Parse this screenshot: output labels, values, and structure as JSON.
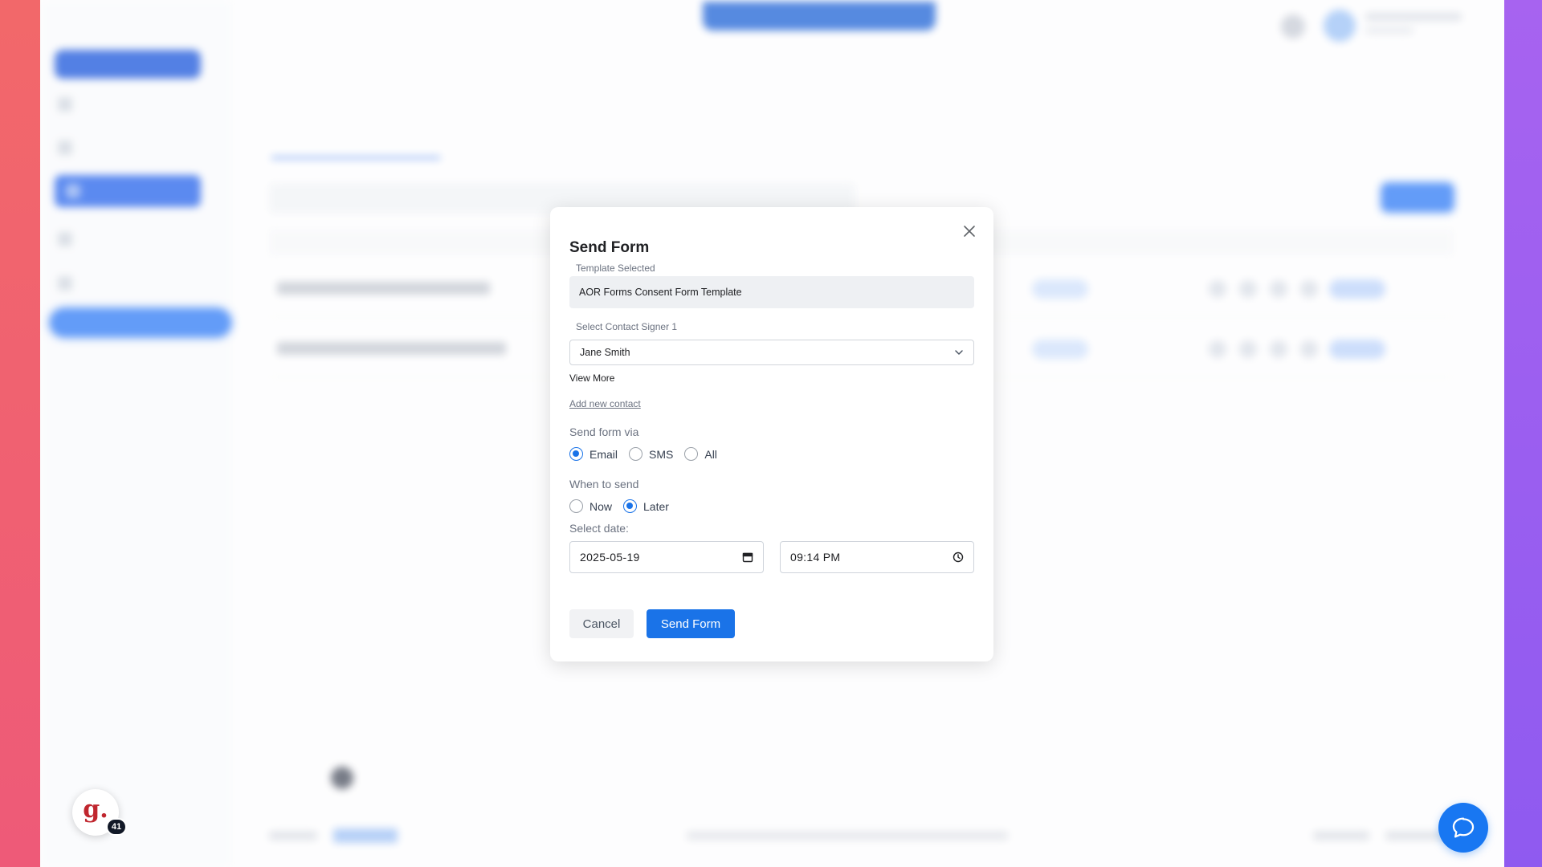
{
  "modal": {
    "title": "Send Form",
    "template_label": "Template Selected",
    "template_value": "AOR Forms Consent Form Template",
    "signer_label": "Select Contact Signer 1",
    "signer_value": "Jane Smith",
    "view_more": "View More",
    "add_contact": "Add new contact",
    "send_via_label": "Send form via",
    "send_via_options": [
      {
        "label": "Email",
        "checked": true
      },
      {
        "label": "SMS",
        "checked": false
      },
      {
        "label": "All",
        "checked": false
      }
    ],
    "when_label": "When to send",
    "when_options": [
      {
        "label": "Now",
        "checked": false
      },
      {
        "label": "Later",
        "checked": true
      }
    ],
    "date_label": "Select date:",
    "date_value": "2025-05-19",
    "time_value": "09:14 PM",
    "cancel_label": "Cancel",
    "submit_label": "Send Form"
  },
  "widgets": {
    "g_letter": "g.",
    "g_badge": "41"
  },
  "colors": {
    "primary": "#1a73e8",
    "left_gradient": "#f2686a",
    "right_gradient": "#a763f0"
  }
}
